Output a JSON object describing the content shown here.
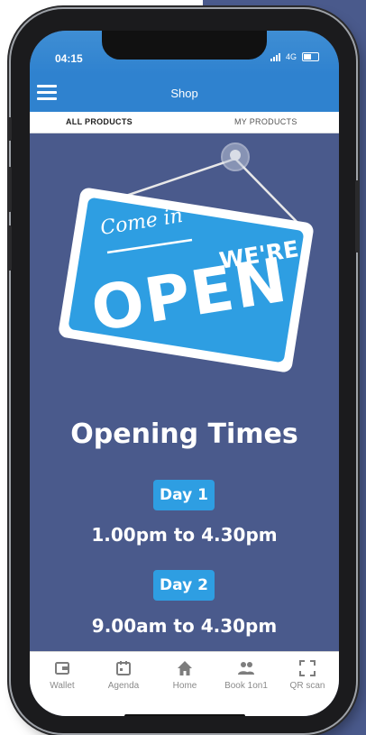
{
  "status": {
    "time": "04:15",
    "network": "4G"
  },
  "header": {
    "title": "Shop",
    "menu_icon": "hamburger-menu-icon"
  },
  "tabs": [
    {
      "label": "ALL PRODUCTS",
      "active": true
    },
    {
      "label": "MY PRODUCTS",
      "active": false
    }
  ],
  "sign": {
    "line1": "Come in",
    "line2": "WE'RE",
    "line3": "OPEN"
  },
  "opening": {
    "title": "Opening Times",
    "days": [
      {
        "label": "Day 1",
        "hours": "1.00pm to 4.30pm"
      },
      {
        "label": "Day 2",
        "hours": "9.00am to 4.30pm"
      }
    ]
  },
  "bottom_nav": [
    {
      "label": "Wallet",
      "icon": "wallet-icon"
    },
    {
      "label": "Agenda",
      "icon": "calendar-icon"
    },
    {
      "label": "Home",
      "icon": "home-icon"
    },
    {
      "label": "Book 1on1",
      "icon": "people-icon"
    },
    {
      "label": "QR scan",
      "icon": "qr-scan-icon"
    }
  ],
  "colors": {
    "background_navy": "#4a5a8c",
    "app_bar_blue": "#2f82cf",
    "sign_blue": "#2e9ee2",
    "badge_blue": "#2e9ee2",
    "nav_grey": "#8b8b8b"
  }
}
